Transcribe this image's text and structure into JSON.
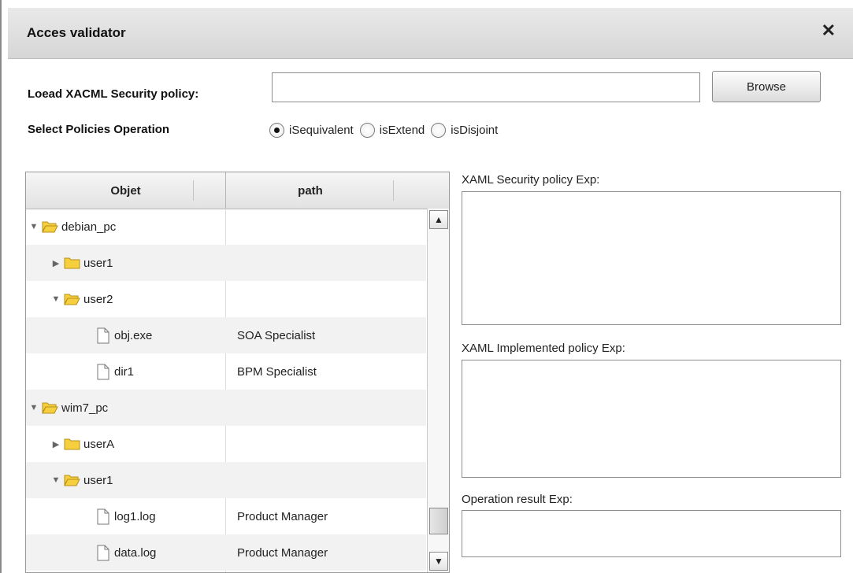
{
  "window": {
    "title": "Acces validator",
    "close_glyph": "✕"
  },
  "form": {
    "load_label": "Loead XACML Security policy:",
    "file_value": "",
    "browse_label": "Browse",
    "operation_label": "Select Policies Operation",
    "options": [
      {
        "label": "iSequivalent",
        "selected": true
      },
      {
        "label": "isExtend",
        "selected": false
      },
      {
        "label": "isDisjoint",
        "selected": false
      }
    ]
  },
  "tree": {
    "columns": [
      "Objet",
      "path"
    ],
    "rows": [
      {
        "level": 0,
        "type": "folder",
        "state": "expanded",
        "name": "debian_pc",
        "path": ""
      },
      {
        "level": 1,
        "type": "folder",
        "state": "collapsed",
        "name": "user1",
        "path": ""
      },
      {
        "level": 1,
        "type": "folder",
        "state": "expanded",
        "name": "user2",
        "path": ""
      },
      {
        "level": 2,
        "type": "file",
        "state": "",
        "name": "obj.exe",
        "path": "SOA Specialist"
      },
      {
        "level": 2,
        "type": "file",
        "state": "",
        "name": "dir1",
        "path": "BPM Specialist"
      },
      {
        "level": 0,
        "type": "folder",
        "state": "expanded",
        "name": "wim7_pc",
        "path": ""
      },
      {
        "level": 1,
        "type": "folder",
        "state": "collapsed",
        "name": "userA",
        "path": ""
      },
      {
        "level": 1,
        "type": "folder",
        "state": "expanded",
        "name": "user1",
        "path": ""
      },
      {
        "level": 2,
        "type": "file",
        "state": "",
        "name": "log1.log",
        "path": "Product Manager"
      },
      {
        "level": 2,
        "type": "file",
        "state": "",
        "name": "data.log",
        "path": "Product Manager"
      }
    ],
    "scroll_up_glyph": "▲",
    "scroll_down_glyph": "▼"
  },
  "panels": {
    "security_label": "XAML Security policy Exp:",
    "implemented_label": "XAML Implemented policy Exp:",
    "result_label": "Operation result Exp:"
  },
  "colors": {
    "folder": "#f5cf3e",
    "folder_edge": "#b8901a",
    "header_bg": "#e0e0e0"
  }
}
